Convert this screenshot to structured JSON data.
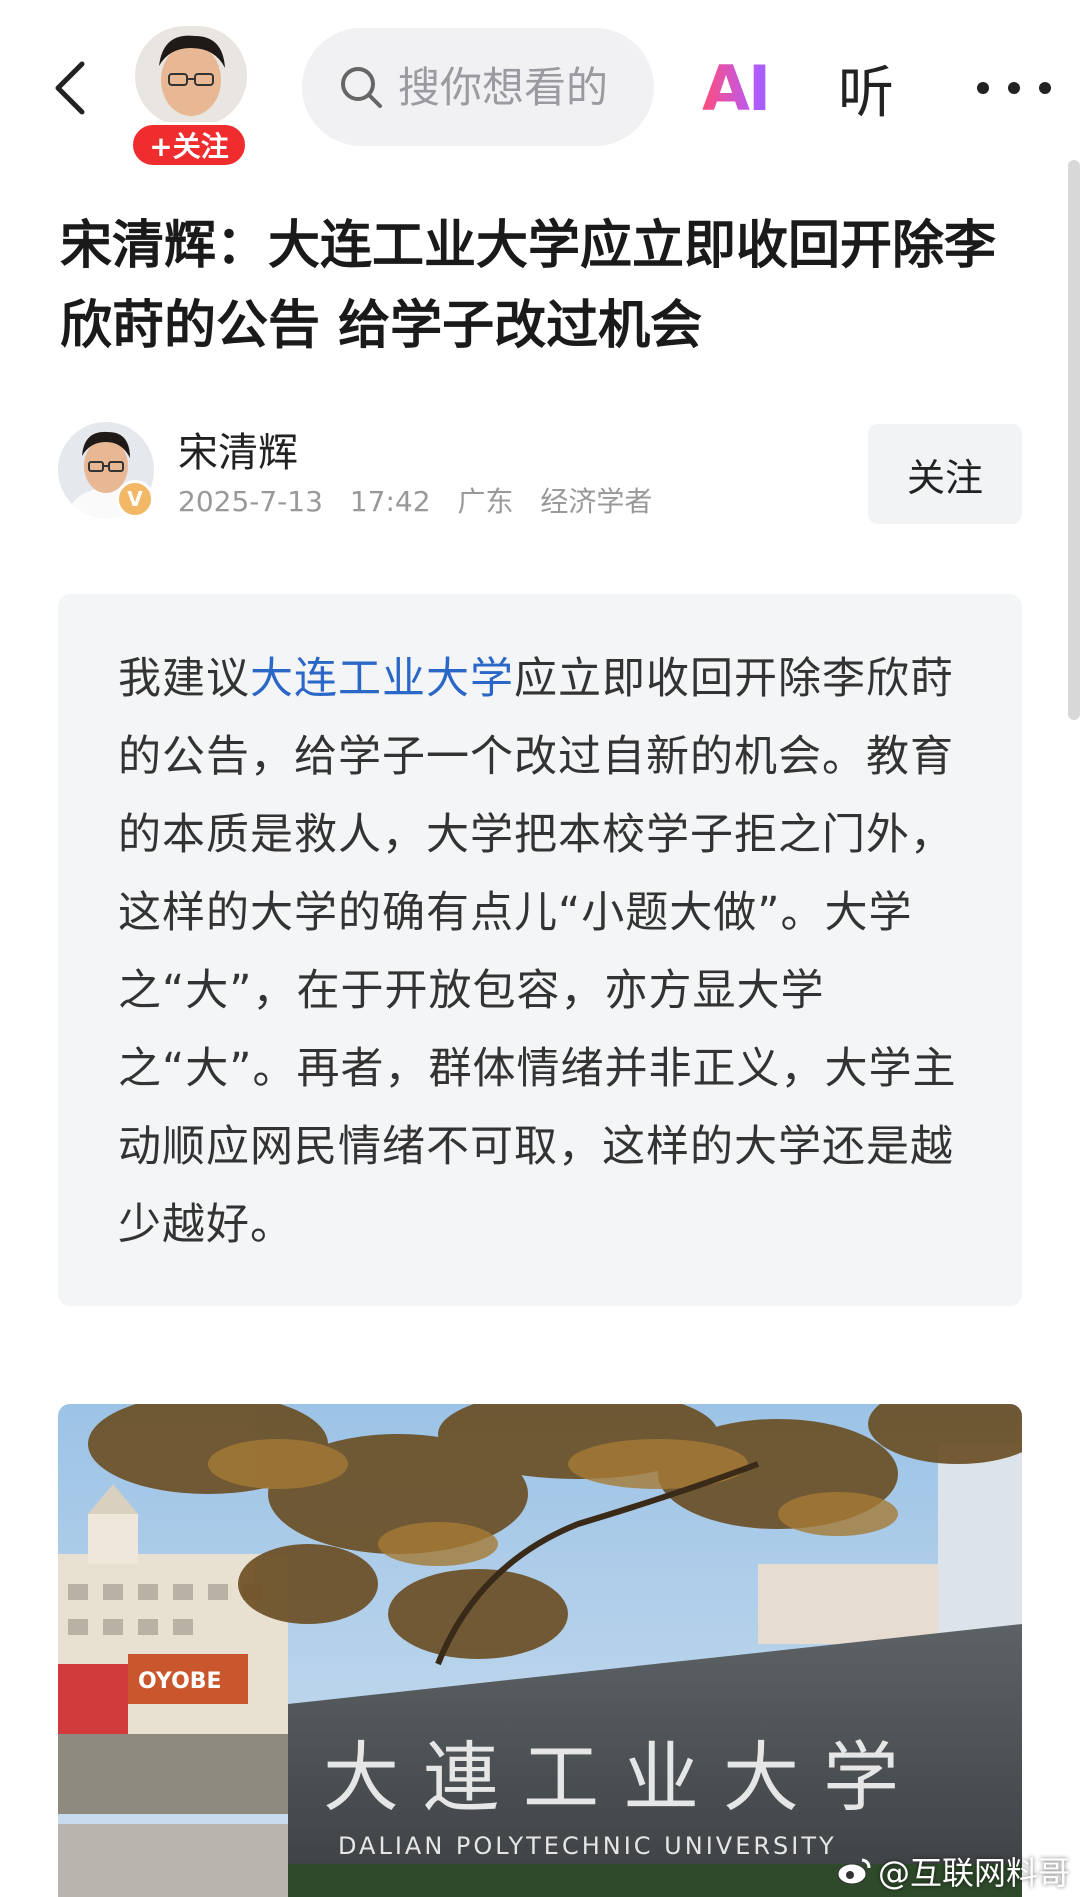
{
  "topbar": {
    "follow_chip_label": "+关注",
    "search_placeholder": "搜你想看的",
    "ai_label": "AI",
    "listen_label": "听"
  },
  "article": {
    "title": "宋清辉：大连工业大学应立即收回开除李欣莳的公告 给学子改过机会",
    "author": {
      "name": "宋清辉",
      "badge": "V",
      "date": "2025-7-13",
      "time": "17:42",
      "region": "广东",
      "role": "经济学者",
      "follow_label": "关注"
    },
    "quote": {
      "prefix": "我建议",
      "link": "大连工业大学",
      "body": "应立即收回开除李欣莳的公告，给学子一个改过自新的机会。教育的本质是救人，大学把本校学子拒之门外，这样的大学的确有点儿“小题大做”。大学之“大”，在于开放包容，亦方显大学之“大”。再者，群体情绪并非正义，大学主动顺应网民情绪不可取，这样的大学还是越少越好。"
    },
    "image": {
      "sign_chinese": "大連工业大学",
      "sign_english": "DALIAN POLYTECHNIC UNIVERSITY",
      "shop_sign": "OYOBE"
    }
  },
  "watermark": {
    "text": "@互联网料哥"
  },
  "colors": {
    "accent_red": "#ef2d2f",
    "link_blue": "#2a67c6",
    "quote_bg": "#f4f5f7"
  }
}
